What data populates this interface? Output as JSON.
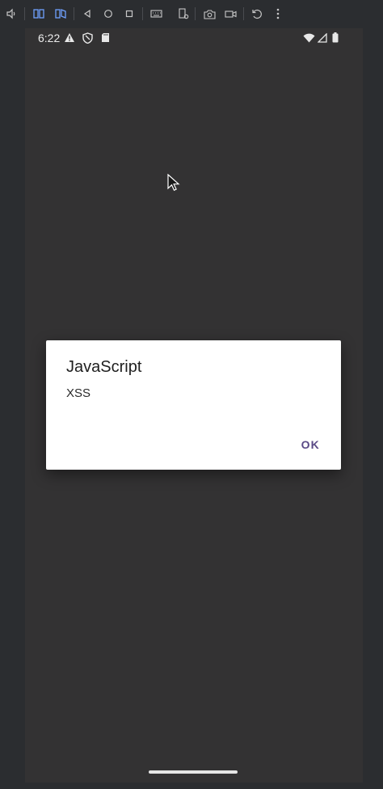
{
  "toolbar": {
    "icons": [
      "volume-icon",
      "fold-left-icon",
      "fold-right-icon",
      "back-icon",
      "home-icon",
      "overview-icon",
      "keyboard-icon",
      "settings-phone-icon",
      "camera-icon",
      "video-icon",
      "rotate-icon",
      "more-icon"
    ]
  },
  "statusbar": {
    "time": "6:22",
    "left_icons": [
      "warning-icon",
      "shield-icon",
      "sdcard-icon"
    ],
    "right_icons": [
      "wifi-icon",
      "signal-icon",
      "battery-icon"
    ]
  },
  "dialog": {
    "title": "JavaScript",
    "message": "XSS",
    "ok_label": "OK"
  },
  "colors": {
    "screen_bg": "#333233",
    "dialog_bg": "#ffffff",
    "accent": "#5a4a86"
  }
}
